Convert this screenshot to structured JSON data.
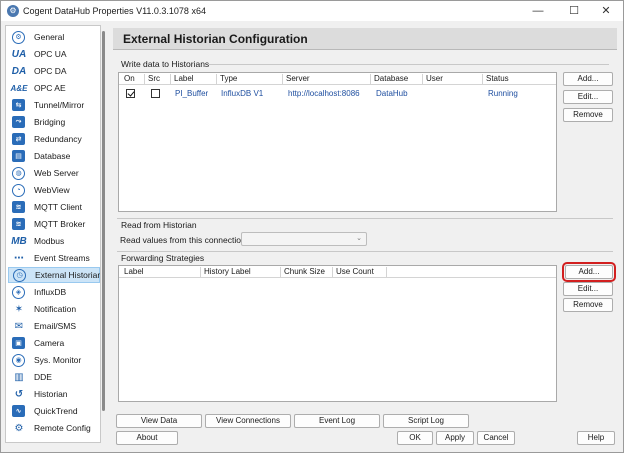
{
  "window": {
    "title": "Cogent DataHub Properties V11.0.3.1078 x64",
    "minimize": "—",
    "maximize": "☐",
    "close": "✕"
  },
  "sidebar": {
    "items": [
      {
        "label": "General",
        "icon": "gear-icon",
        "glyph": "⚙"
      },
      {
        "label": "OPC UA",
        "icon": "ua-icon",
        "glyph": "UA"
      },
      {
        "label": "OPC DA",
        "icon": "da-icon",
        "glyph": "DA"
      },
      {
        "label": "OPC AE",
        "icon": "ae-icon",
        "glyph": "A&E"
      },
      {
        "label": "Tunnel/Mirror",
        "icon": "tunnel-icon",
        "glyph": "⇆"
      },
      {
        "label": "Bridging",
        "icon": "bridging-icon",
        "glyph": "⤳"
      },
      {
        "label": "Redundancy",
        "icon": "redundancy-icon",
        "glyph": "⇄"
      },
      {
        "label": "Database",
        "icon": "database-icon",
        "glyph": "▤"
      },
      {
        "label": "Web Server",
        "icon": "globe-icon",
        "glyph": "◍"
      },
      {
        "label": "WebView",
        "icon": "webview-icon",
        "glyph": "◔"
      },
      {
        "label": "MQTT Client",
        "icon": "mqtt-client-icon",
        "glyph": "≋"
      },
      {
        "label": "MQTT Broker",
        "icon": "mqtt-broker-icon",
        "glyph": "≋"
      },
      {
        "label": "Modbus",
        "icon": "modbus-icon",
        "glyph": "MB"
      },
      {
        "label": "Event Streams",
        "icon": "event-streams-icon",
        "glyph": "⋯"
      },
      {
        "label": "External Historian",
        "icon": "historian-icon",
        "glyph": "◷"
      },
      {
        "label": "InfluxDB",
        "icon": "influxdb-icon",
        "glyph": "◈"
      },
      {
        "label": "Notification",
        "icon": "notification-icon",
        "glyph": "✶"
      },
      {
        "label": "Email/SMS",
        "icon": "email-icon",
        "glyph": "✉"
      },
      {
        "label": "Camera",
        "icon": "camera-icon",
        "glyph": "▣"
      },
      {
        "label": "Sys. Monitor",
        "icon": "monitor-icon",
        "glyph": "◉"
      },
      {
        "label": "DDE",
        "icon": "dde-icon",
        "glyph": "▥"
      },
      {
        "label": "Historian",
        "icon": "history-icon",
        "glyph": "↺"
      },
      {
        "label": "QuickTrend",
        "icon": "trend-icon",
        "glyph": "∿"
      },
      {
        "label": "Remote Config",
        "icon": "remote-config-icon",
        "glyph": "⚙"
      }
    ],
    "selected": "External Historian"
  },
  "header": {
    "title": "External Historian Configuration"
  },
  "write_group": {
    "label": "Write data to Historians",
    "columns": [
      "On",
      "Src",
      "Label",
      "Type",
      "Server",
      "Database",
      "User",
      "Status"
    ],
    "rows": [
      {
        "on": true,
        "src": false,
        "label": "PI_Buffer",
        "type": "InfluxDB V1",
        "server": "http://localhost:8086",
        "database": "DataHub",
        "user": "",
        "status": "Running"
      }
    ],
    "buttons": {
      "add": "Add...",
      "edit": "Edit...",
      "remove": "Remove"
    }
  },
  "read_group": {
    "label": "Read from Historian",
    "field_label": "Read values from this connection",
    "field_value": ""
  },
  "forward_group": {
    "label": "Forwarding Strategies",
    "columns": [
      "Label",
      "History Label",
      "Chunk Size",
      "Use Count"
    ],
    "buttons": {
      "add": "Add...",
      "edit": "Edit...",
      "remove": "Remove"
    }
  },
  "bottom": {
    "view_data": "View Data",
    "view_connections": "View Connections",
    "event_log": "Event Log",
    "script_log": "Script Log",
    "about": "About",
    "ok": "OK",
    "apply": "Apply",
    "cancel": "Cancel",
    "help": "Help"
  }
}
